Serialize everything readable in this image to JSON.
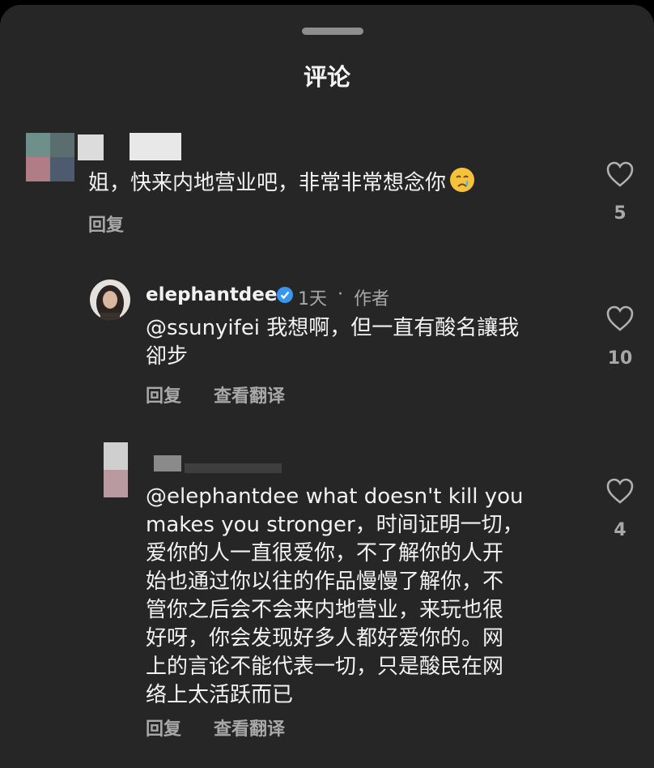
{
  "header": {
    "title": "评论"
  },
  "comments": [
    {
      "text": "姐，快来内地营业吧，非常非常想念你",
      "emoji": "crying-face",
      "reply_label": "回复",
      "like_count": "5"
    },
    {
      "username": "elephantdee",
      "verified": true,
      "time": "1天",
      "separator": "·",
      "role": "作者",
      "text_line1": "@ssunyifei 我想啊，但一直有酸名讓我",
      "text_line2": "卻步",
      "reply_label": "回复",
      "translate_label": "查看翻译",
      "like_count": "10"
    },
    {
      "lines": [
        "@elephantdee what doesn't kill you",
        "makes you stronger，时间证明一切，",
        "爱你的人一直很爱你，不了解你的人开",
        "始也通过你以往的作品慢慢了解你，不",
        "管你之后会不会来内地营业，来玩也很",
        "好呀，你会发现好多人都好爱你的。网",
        "上的言论不能代表一切，只是酸民在网",
        "络上太活跃而已"
      ],
      "reply_label": "回复",
      "translate_label": "查看翻译",
      "like_count": "4"
    }
  ],
  "colors": {
    "sheet": "#262626",
    "text": "#f2f2f2",
    "muted": "#a8a8a8",
    "verified": "#3797f0"
  }
}
